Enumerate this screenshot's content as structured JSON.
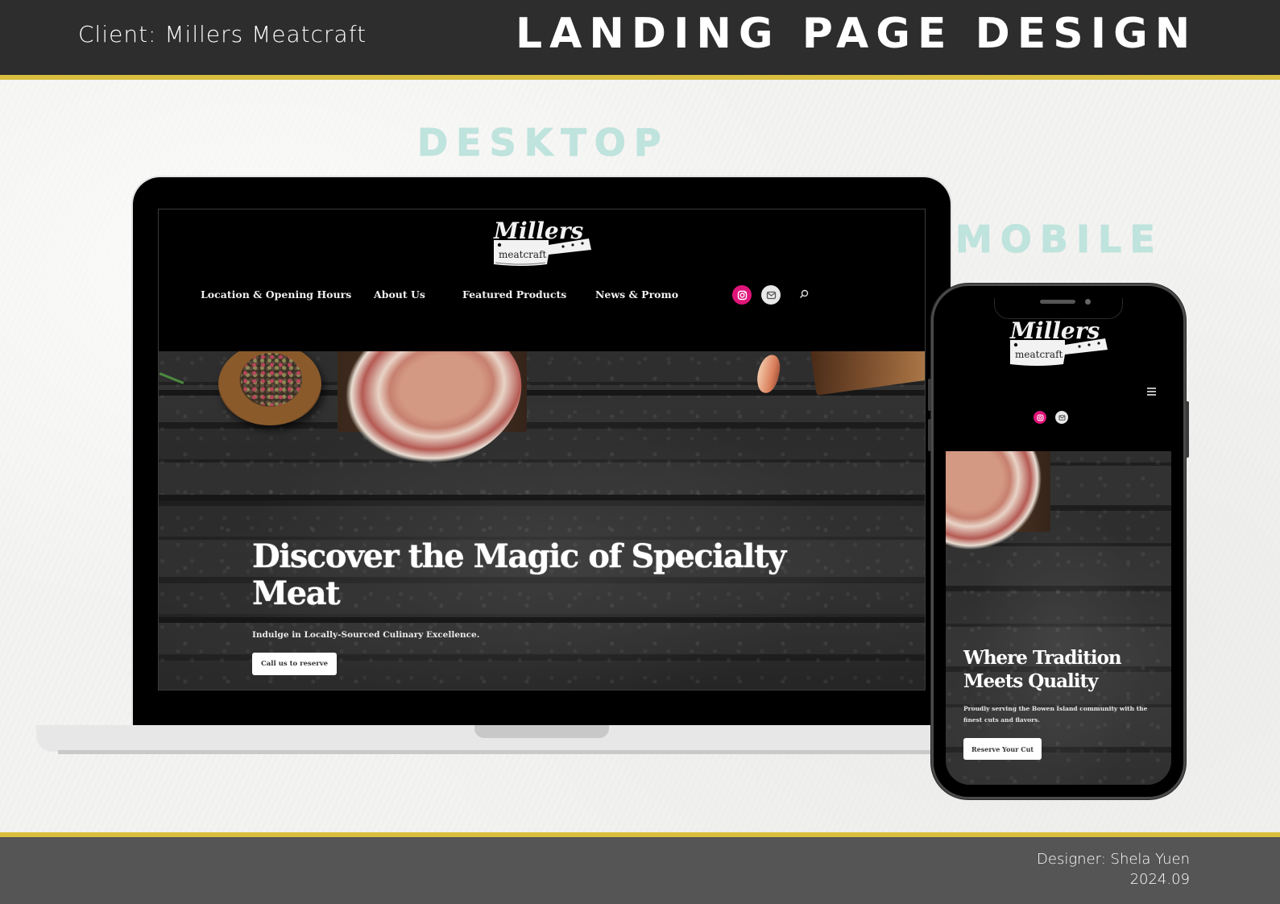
{
  "header": {
    "client_label": "Client: Millers Meatcraft",
    "title": "LANDING PAGE DESIGN"
  },
  "sections": {
    "desktop_label": "DESKTOP",
    "mobile_label": "MOBILE"
  },
  "brand": {
    "logo_script": "Millers",
    "logo_sub": "meatcraft",
    "instagram_color": "#e0157a",
    "email_icon_bg": "#e8e8e8",
    "accent_rule": "#d9bf3d",
    "section_label_color": "#bfe3dd"
  },
  "desktop_site": {
    "nav": [
      {
        "label": "Location & Opening Hours"
      },
      {
        "label": "About Us"
      },
      {
        "label": "Featured Products"
      },
      {
        "label": "News & Promo"
      }
    ],
    "social_icons": [
      "instagram-icon",
      "email-icon"
    ],
    "search_icon": "search-icon",
    "hero": {
      "title": "Discover the Magic of Specialty Meat",
      "subtitle": "Indulge in Locally-Sourced Culinary Excellence.",
      "cta": "Call us to reserve"
    }
  },
  "mobile_site": {
    "menu_icon": "hamburger-menu-icon",
    "social_icons": [
      "instagram-icon",
      "email-icon"
    ],
    "hero": {
      "title": "Where Tradition Meets Quality",
      "subtitle": "Proudly serving the Bowen Island community with the finest cuts and flavors.",
      "cta": "Reserve Your Cut"
    }
  },
  "footer": {
    "designer": "Designer: Shela Yuen",
    "date": "2024.09"
  }
}
